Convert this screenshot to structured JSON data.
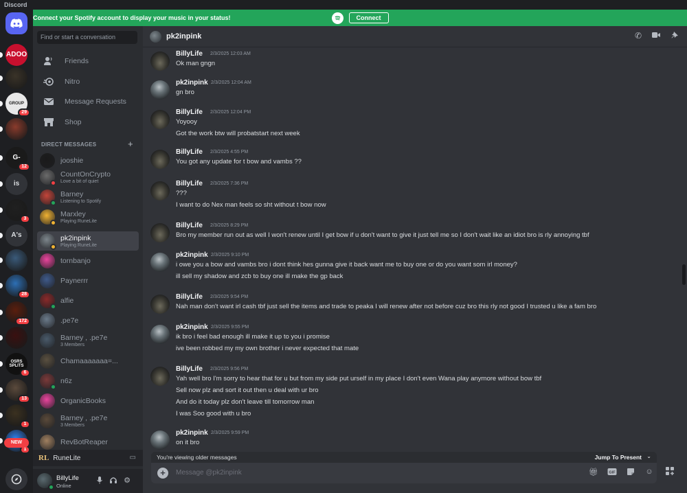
{
  "app": {
    "title": "Discord"
  },
  "banner": {
    "message": "Connect your Spotify account to display your music in your status!",
    "button": "Connect",
    "color": "#23a55a"
  },
  "servers": [
    {
      "label": "",
      "icon": "discord-home-icon",
      "color": "#5865f2"
    },
    {
      "label": "ADOO",
      "color": "#c8102e"
    },
    {
      "label": "",
      "color": "#3a3328"
    },
    {
      "label": "GROUP",
      "badge": "29",
      "color": "#e8e8e8"
    },
    {
      "label": "",
      "color": "#8a3b2c"
    },
    {
      "label": "G-",
      "badge": "12",
      "color": "#1a1a1a"
    },
    {
      "label": "is",
      "color": "#313338"
    },
    {
      "label": "",
      "badge": "3",
      "color": "#202020"
    },
    {
      "label": "A's",
      "color": "#313338"
    },
    {
      "label": "",
      "color": "#3a5a7a"
    },
    {
      "label": "",
      "badge": "28",
      "color": "#2d6fb5"
    },
    {
      "label": "",
      "badge": "172",
      "color": "#5a1e0e"
    },
    {
      "label": "",
      "color": "#3a1010"
    },
    {
      "label": "OSRS SPLITS",
      "badge": "6",
      "color": "#111"
    },
    {
      "label": "",
      "badge": "13",
      "color": "#5b4a3c"
    },
    {
      "label": "",
      "badge": "1",
      "color": "#3b3120"
    },
    {
      "label": "",
      "badge": "1",
      "color": "#2f80ed"
    },
    {
      "label": "",
      "icon": "discovery-icon",
      "color": "#313338"
    }
  ],
  "server_new_label": "NEW",
  "sidebar": {
    "search_placeholder": "Find or start a conversation",
    "nav": [
      {
        "label": "Friends",
        "icon": "friends-icon"
      },
      {
        "label": "Nitro",
        "icon": "nitro-icon"
      },
      {
        "label": "Message Requests",
        "icon": "mail-icon"
      },
      {
        "label": "Shop",
        "icon": "shop-icon"
      }
    ],
    "dm_header": "DIRECT MESSAGES",
    "dms": [
      {
        "name": "jooshie",
        "sub": "",
        "status": "",
        "color": "#1a1a1a"
      },
      {
        "name": "CountOnCrypto",
        "sub": "Love a bit of quiet",
        "status": "#f23f43",
        "color": "#6b6b6b"
      },
      {
        "name": "Barney",
        "sub": "Listening to Spotify",
        "status": "#23a55a",
        "color": "#c4453a"
      },
      {
        "name": "Marxley",
        "sub": "Playing RuneLite",
        "status": "#f0b232",
        "color": "#f0b232"
      },
      {
        "name": "pk2inpink",
        "sub": "Playing RuneLite",
        "status": "#f0b232",
        "color": "#7d868c"
      },
      {
        "name": "tornbanjo",
        "sub": "",
        "status": "",
        "color": "#eb459e"
      },
      {
        "name": "Paynerrr",
        "sub": "",
        "status": "",
        "color": "#3f5a8a"
      },
      {
        "name": "alfie",
        "sub": "",
        "status": "#23a55a",
        "color": "#8a2a2a"
      },
      {
        "name": ".pe7e",
        "sub": "",
        "status": "",
        "color": "#6b7a8a"
      },
      {
        "name": "Barney , .pe7e",
        "sub": "3 Members",
        "status": "",
        "color": "#4a5a6a"
      },
      {
        "name": "Chamaaaaaaa=...",
        "sub": "",
        "status": "",
        "color": "#5a5040"
      },
      {
        "name": "n6z",
        "sub": "",
        "status": "#23a55a",
        "color": "#7a3a3a"
      },
      {
        "name": "OrganicBooks",
        "sub": "",
        "status": "",
        "color": "#eb459e"
      },
      {
        "name": "Barney , .pe7e",
        "sub": "3 Members",
        "status": "",
        "color": "#5a4a3a"
      },
      {
        "name": "RevBotReaper",
        "sub": "",
        "status": "",
        "color": "#a08060"
      }
    ]
  },
  "runelite_bar": {
    "label": "RuneLite"
  },
  "user_panel": {
    "name": "BillyLife",
    "status": "Online"
  },
  "chat": {
    "channel_name": "pk2inpink",
    "messages": [
      {
        "author": "BillyLife",
        "time": "2/3/2025 12:03 AM",
        "avatar": "billy",
        "lines": [
          "Ok man gngn"
        ]
      },
      {
        "author": "pk2inpink",
        "time": "2/3/2025 12:04 AM",
        "avatar": "pk",
        "lines": [
          "gn bro"
        ]
      },
      {
        "author": "BillyLife",
        "time": "2/3/2025 12:04 PM",
        "avatar": "billy",
        "lines": [
          "Yoyooy",
          "Got the work btw will probatstart next week"
        ]
      },
      {
        "author": "BillyLife",
        "time": "2/3/2025 4:55 PM",
        "avatar": "billy",
        "lines": [
          "You got any update for t bow and vambs ??"
        ]
      },
      {
        "author": "BillyLife",
        "time": "2/3/2025 7:36 PM",
        "avatar": "billy",
        "lines": [
          "???",
          "I want to do Nex man feels so sht without t bow now"
        ]
      },
      {
        "author": "BillyLife",
        "time": "2/3/2025 8:29 PM",
        "avatar": "billy",
        "lines": [
          "Bro my member run out as well I won't renew until I get bow if u don't want to give it just tell me so I don't wait like an idiot bro is rly annoying tbf"
        ]
      },
      {
        "author": "pk2inpink",
        "time": "2/3/2025 9:10 PM",
        "avatar": "pk",
        "lines": [
          "i owe you a bow and vambs bro i dont think hes gunna give it back want me to buy one or do you want som irl money?",
          "ill sell my shadow and zcb to buy one ill make the gp back"
        ]
      },
      {
        "author": "BillyLife",
        "time": "2/3/2025 9:54 PM",
        "avatar": "billy",
        "lines": [
          "Nah man don't want irl cash tbf just sell the items and trade to peaka I will renew after not before cuz bro this rly not good I trusted u like a fam bro"
        ]
      },
      {
        "author": "pk2inpink",
        "time": "2/3/2025 9:55 PM",
        "avatar": "pk",
        "lines": [
          "ik bro i feel bad enough ill make it up to you i promise",
          "ive been robbed my my own brother i never expected that mate"
        ]
      },
      {
        "author": "BillyLife",
        "time": "2/3/2025 9:56 PM",
        "avatar": "billy",
        "lines": [
          "Yah well bro I'm sorry to hear that for u but from my side put urself in my place I don't even Wana play anymore without bow tbf",
          "Sell now plz and sort it out then u deal with ur bro",
          "And do it today plz don't leave till tomorrow man",
          "I was Soo good with u bro"
        ]
      },
      {
        "author": "pk2inpink",
        "time": "2/3/2025 9:59 PM",
        "avatar": "pk",
        "lines": [
          "on it bro"
        ]
      }
    ],
    "older_notice": "You're viewing older messages",
    "jump_label": "Jump To Present",
    "composer_placeholder": "Message @pk2inpink"
  }
}
